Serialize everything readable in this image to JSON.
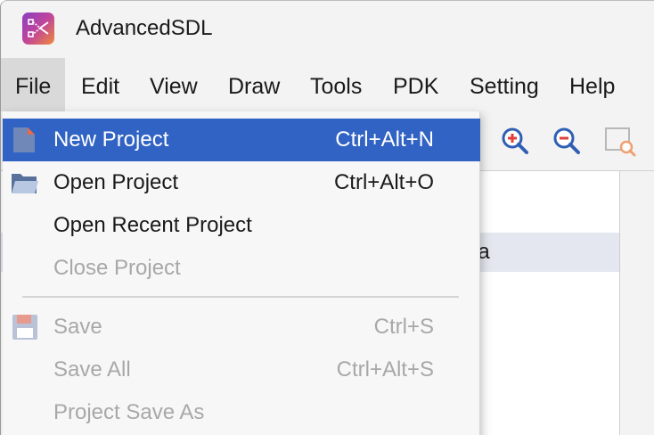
{
  "app": {
    "title": "AdvancedSDL"
  },
  "menubar": {
    "items": [
      {
        "label": "File"
      },
      {
        "label": "Edit"
      },
      {
        "label": "View"
      },
      {
        "label": "Draw"
      },
      {
        "label": "Tools"
      },
      {
        "label": "PDK"
      },
      {
        "label": "Setting"
      },
      {
        "label": "Help"
      }
    ]
  },
  "file_menu": {
    "items": [
      {
        "label": "New Project",
        "shortcut": "Ctrl+Alt+N",
        "icon": "new-project-icon",
        "enabled": true,
        "highlighted": true
      },
      {
        "label": "Open Project",
        "shortcut": "Ctrl+Alt+O",
        "icon": "folder-icon",
        "enabled": true
      },
      {
        "label": "Open Recent Project",
        "shortcut": "",
        "enabled": true
      },
      {
        "label": "Close Project",
        "shortcut": "",
        "enabled": false
      },
      {
        "label": "Save",
        "shortcut": "Ctrl+S",
        "icon": "save-icon",
        "enabled": false
      },
      {
        "label": "Save All",
        "shortcut": "Ctrl+Alt+S",
        "enabled": false
      },
      {
        "label": "Project Save As",
        "shortcut": "",
        "enabled": false
      }
    ]
  },
  "toolbar": {
    "icons": [
      "zoom-in-icon",
      "zoom-out-icon",
      "zoom-fit-icon"
    ]
  },
  "tree": {
    "selected_row_text": "da"
  },
  "colors": {
    "highlight": "#3163c4",
    "disabled_text": "#a8a8a8",
    "zoom_blue": "#2f5fb5",
    "zoom_red": "#e0403a"
  }
}
